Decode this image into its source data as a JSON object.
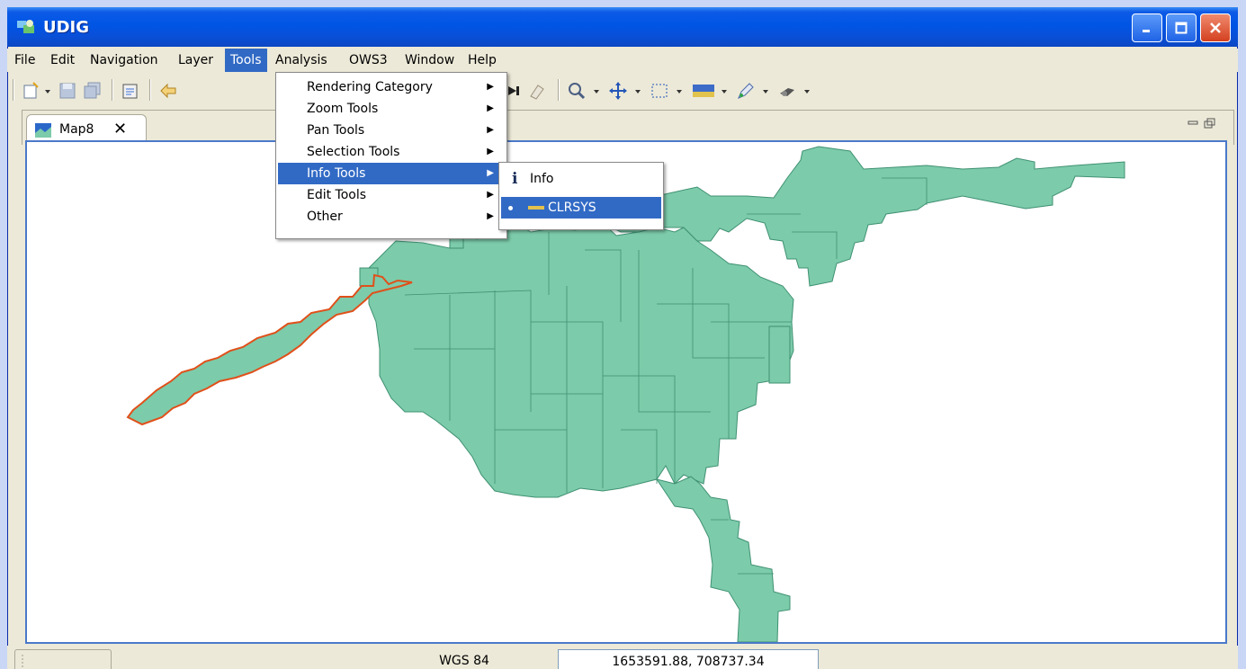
{
  "window": {
    "title": "UDIG"
  },
  "menubar": [
    {
      "label": "File"
    },
    {
      "label": "Edit"
    },
    {
      "label": "Navigation"
    },
    {
      "label": "Layer"
    },
    {
      "label": "Tools"
    },
    {
      "label": "Analysis"
    },
    {
      "label": "OWS3"
    },
    {
      "label": "Window"
    },
    {
      "label": "Help"
    }
  ],
  "tools_menu": [
    {
      "label": "Rendering Category"
    },
    {
      "label": "Zoom Tools"
    },
    {
      "label": "Pan Tools"
    },
    {
      "label": "Selection Tools"
    },
    {
      "label": "Info Tools"
    },
    {
      "label": "Edit Tools"
    },
    {
      "label": "Other"
    }
  ],
  "info_submenu": [
    {
      "label": "Info",
      "icon": "info-icon"
    },
    {
      "label": "CLRSYS",
      "icon": "measure-icon"
    }
  ],
  "editor_tab": {
    "label": "Map8"
  },
  "status": {
    "crs": "WGS 84",
    "coordinates": "1653591.88, 708737.34"
  },
  "colors": {
    "polygon_fill": "#7ccbaa",
    "polygon_stroke": "#3f9173",
    "selection_stroke": "#e0501a",
    "menu_highlight": "#316ac5"
  }
}
